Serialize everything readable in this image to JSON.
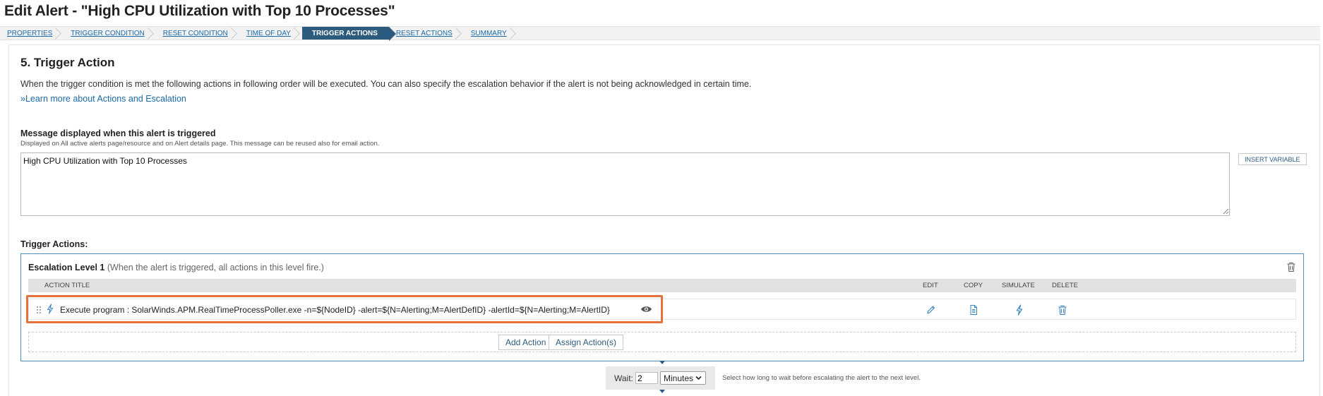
{
  "page_title": "Edit Alert - \"High CPU Utilization with Top 10 Processes\"",
  "wizard_steps": [
    {
      "label": "PROPERTIES",
      "active": false
    },
    {
      "label": "TRIGGER CONDITION",
      "active": false
    },
    {
      "label": "RESET CONDITION",
      "active": false
    },
    {
      "label": "TIME OF DAY",
      "active": false
    },
    {
      "label": "TRIGGER ACTIONS",
      "active": true
    },
    {
      "label": "RESET ACTIONS",
      "active": false
    },
    {
      "label": "SUMMARY",
      "active": false
    }
  ],
  "section": {
    "title": "5. Trigger Action",
    "intro": "When the trigger condition is met the following actions in following order will be executed. You can also specify the escalation behavior if the alert is not being acknowledged in certain time.",
    "learn_more": "»Learn more about Actions and Escalation"
  },
  "message": {
    "label": "Message displayed when this alert is triggered",
    "help": "Displayed on All active alerts page/resource and on Alert details page. This message can be reused also for email action.",
    "value": "High CPU Utilization with Top 10 Processes",
    "insert_variable": "INSERT VARIABLE"
  },
  "trigger_actions": {
    "label": "Trigger Actions:",
    "escalation_level": "Escalation Level 1",
    "escalation_note": "(When the alert is triggered, all actions in this level fire.)",
    "columns": {
      "action_title": "ACTION TITLE",
      "edit": "EDIT",
      "copy": "COPY",
      "simulate": "SIMULATE",
      "delete": "DELETE"
    },
    "actions": [
      {
        "title": "Execute program : SolarWinds.APM.RealTimeProcessPoller.exe -n=${NodeID} -alert=${N=Alerting;M=AlertDefID} -alertId=${N=Alerting;M=AlertID}"
      }
    ],
    "add_action": "Add Action",
    "assign_actions": "Assign Action(s)"
  },
  "wait": {
    "label": "Wait:",
    "value": "2",
    "unit": "Minutes",
    "help": "Select how long to wait before escalating the alert to the next level."
  },
  "colors": {
    "accent": "#2d5b7d",
    "link": "#1a6aa8",
    "escalation_border": "#4a90c2",
    "highlight": "#e8703b"
  }
}
